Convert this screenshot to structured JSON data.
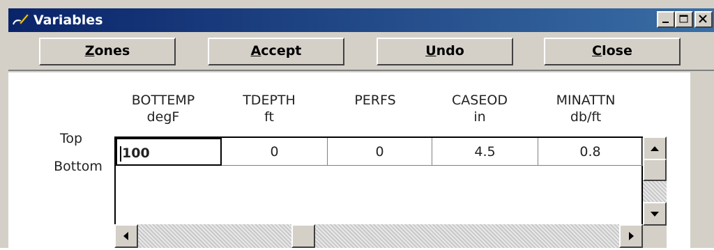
{
  "window": {
    "title": "Variables",
    "icon": "pencil-icon",
    "title_bar_color": "#0a246a"
  },
  "toolbar": {
    "zones": {
      "accel": "Z",
      "rest": "ones"
    },
    "accept": {
      "accel": "A",
      "rest": "ccept"
    },
    "undo": {
      "accel": "U",
      "rest": "ndo"
    },
    "close": {
      "accel": "C",
      "rest": "lose"
    }
  },
  "columns": [
    {
      "name": "BOTTEMP",
      "unit": "degF"
    },
    {
      "name": "TDEPTH",
      "unit": "ft"
    },
    {
      "name": "PERFS",
      "unit": ""
    },
    {
      "name": "CASEOD",
      "unit": "in"
    },
    {
      "name": "MINATTN",
      "unit": "db/ft"
    }
  ],
  "rows": {
    "top_label": "Top",
    "bottom_label": "Bottom",
    "values": [
      "100",
      "0",
      "0",
      "4.5",
      "0.8"
    ]
  }
}
